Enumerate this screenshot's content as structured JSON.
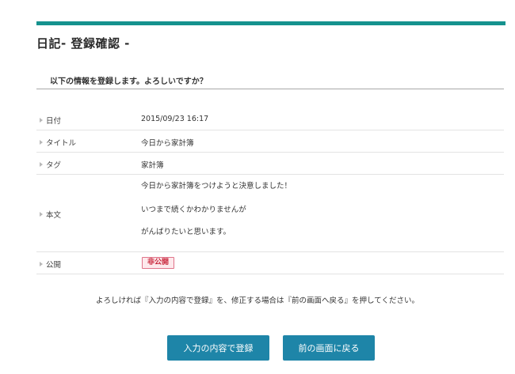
{
  "header": {
    "title": "日記- 登録確認 -"
  },
  "notice": "以下の情報を登録します。よろしいですか？",
  "fields": {
    "date": {
      "label": "日付",
      "value": "2015/09/23 16:17"
    },
    "title": {
      "label": "タイトル",
      "value": "今日から家計簿"
    },
    "tag": {
      "label": "タグ",
      "value": "家計簿"
    },
    "body": {
      "label": "本文",
      "lines": [
        "今日から家計簿をつけようと決意しました！",
        "いつまで続くかわかりませんが",
        "がんばりたいと思います。"
      ]
    },
    "visibility": {
      "label": "公開",
      "value": "非公開"
    }
  },
  "instruction": "よろしければ『入力の内容で登録』を、修正する場合は『前の画面へ戻る』を押してください。",
  "buttons": {
    "submit": "入力の内容で登録",
    "back": "前の画面に戻る"
  },
  "colors": {
    "accent": "#15928e",
    "button": "#1e85a8",
    "badge_text": "#c8253a",
    "badge_bg": "#fde9ec"
  }
}
